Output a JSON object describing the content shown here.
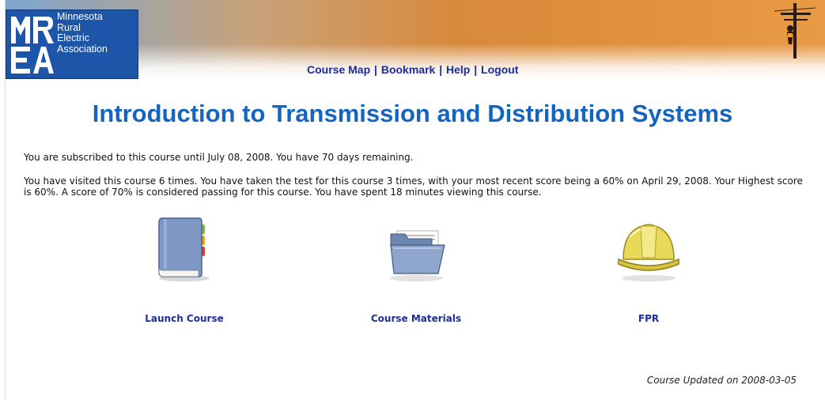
{
  "logo": {
    "lines": [
      "Minnesota",
      "Rural",
      "Electric",
      "Association"
    ]
  },
  "nav": {
    "course_map": "Course Map",
    "bookmark": "Bookmark",
    "help": "Help",
    "logout": "Logout",
    "separator": "|"
  },
  "course": {
    "title": "Introduction to Transmission and Distribution Systems",
    "subscription_text": "You are subscribed to this course until July 08, 2008. You have 70 days remaining.",
    "stats_text": "You have visited this course 6 times. You have taken the test for this course 3 times, with your most recent score being a 60% on April 29, 2008. Your Highest score is 60%. A score of 70% is considered passing for this course. You have spent 18 minutes viewing this course.",
    "updated": "Course Updated on 2008-03-05"
  },
  "actions": {
    "launch": "Launch Course",
    "materials": "Course Materials",
    "fpr": "FPR"
  },
  "icons": {
    "launch": "book-icon",
    "materials": "folder-icon",
    "fpr": "hard-hat-icon",
    "header_art": "utility-pole-icon"
  },
  "colors": {
    "link": "#1b2f9c",
    "title": "#1565c0",
    "logo_bg": "#1d56a8"
  }
}
